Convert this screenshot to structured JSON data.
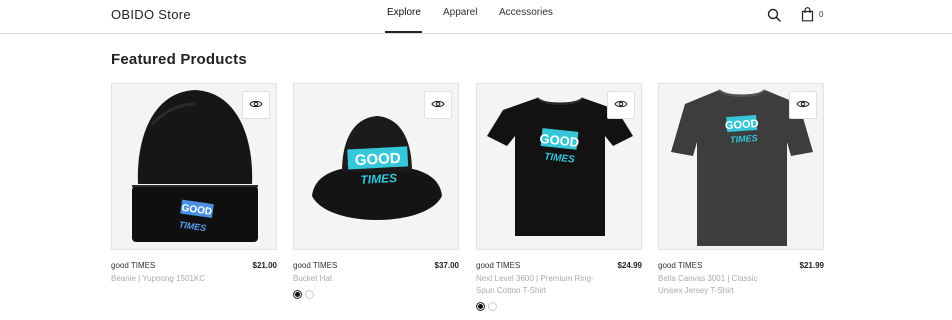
{
  "header": {
    "brand": "OBIDO Store",
    "nav": [
      {
        "label": "Explore",
        "active": true
      },
      {
        "label": "Apparel",
        "active": false
      },
      {
        "label": "Accessories",
        "active": false
      }
    ],
    "search_icon": "search-icon",
    "cart_icon": "shopping-bag-icon",
    "cart_count": "0"
  },
  "main": {
    "section_title": "Featured Products",
    "products": [
      {
        "name": "good TIMES",
        "subtitle": "Beanie | Yupoong 1501KC",
        "price": "$21.00",
        "colors": []
      },
      {
        "name": "good TIMES",
        "subtitle": "Bucket Hat",
        "price": "$37.00",
        "colors": [
          "#111111",
          "#ffffff"
        ]
      },
      {
        "name": "good TIMES",
        "subtitle": "Next Level 3600 | Premium Ring-Spun Cotton T-Shirt",
        "price": "$24.99",
        "colors": [
          "#111111",
          "#ffffff"
        ]
      },
      {
        "name": "good TIMES",
        "subtitle": "Bella Canvas 3001 | Classic Unisex Jersey T-Shirt",
        "price": "$21.99",
        "colors": []
      }
    ],
    "quickview_icon": "eye-icon",
    "logo_text": [
      "GOOD",
      "TIMES"
    ]
  }
}
